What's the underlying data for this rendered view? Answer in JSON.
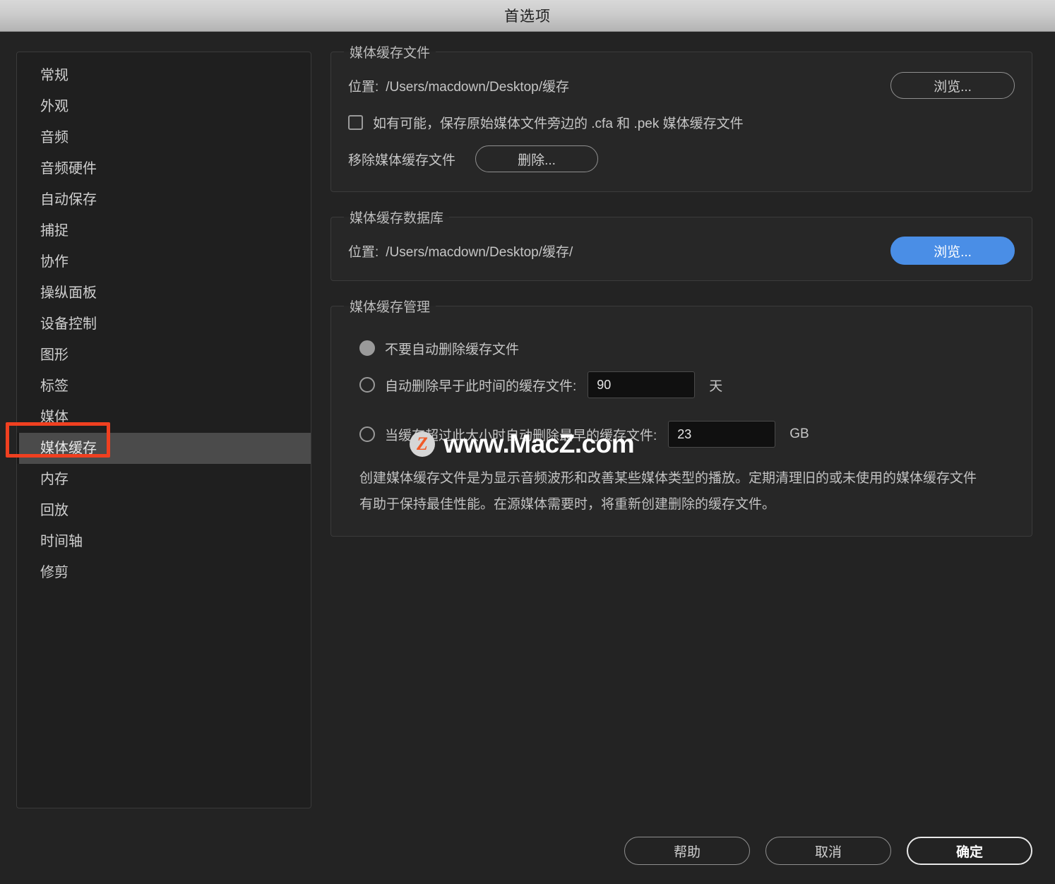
{
  "window": {
    "title": "首选项"
  },
  "sidebar": {
    "items": [
      {
        "label": "常规",
        "selected": false
      },
      {
        "label": "外观",
        "selected": false
      },
      {
        "label": "音频",
        "selected": false
      },
      {
        "label": "音频硬件",
        "selected": false
      },
      {
        "label": "自动保存",
        "selected": false
      },
      {
        "label": "捕捉",
        "selected": false
      },
      {
        "label": "协作",
        "selected": false
      },
      {
        "label": "操纵面板",
        "selected": false
      },
      {
        "label": "设备控制",
        "selected": false
      },
      {
        "label": "图形",
        "selected": false
      },
      {
        "label": "标签",
        "selected": false
      },
      {
        "label": "媒体",
        "selected": false
      },
      {
        "label": "媒体缓存",
        "selected": true
      },
      {
        "label": "内存",
        "selected": false
      },
      {
        "label": "回放",
        "selected": false
      },
      {
        "label": "时间轴",
        "selected": false
      },
      {
        "label": "修剪",
        "selected": false
      }
    ]
  },
  "media_cache_files": {
    "legend": "媒体缓存文件",
    "location_label": "位置:",
    "location_value": "/Users/macdown/Desktop/缓存",
    "browse_button": "浏览...",
    "checkbox_label": "如有可能，保存原始媒体文件旁边的 .cfa 和 .pek 媒体缓存文件",
    "checkbox_checked": false,
    "remove_label": "移除媒体缓存文件",
    "delete_button": "删除..."
  },
  "media_cache_database": {
    "legend": "媒体缓存数据库",
    "location_label": "位置:",
    "location_value": "/Users/macdown/Desktop/缓存/",
    "browse_button": "浏览...",
    "browse_button_color": "#4a8ee6"
  },
  "media_cache_management": {
    "legend": "媒体缓存管理",
    "option_never": "不要自动删除缓存文件",
    "option_older_than": "自动删除早于此时间的缓存文件:",
    "days_value": "90",
    "days_unit": "天",
    "option_exceeds_size": "当缓存超过此大小时自动删除最早的缓存文件:",
    "size_value": "23",
    "size_unit": "GB",
    "selected_option": "option_never",
    "description": "创建媒体缓存文件是为显示音频波形和改善某些媒体类型的播放。定期清理旧的或未使用的媒体缓存文件有助于保持最佳性能。在源媒体需要时，将重新创建删除的缓存文件。"
  },
  "footer": {
    "help_button": "帮助",
    "cancel_button": "取消",
    "ok_button": "确定"
  },
  "watermark": {
    "logo_letter": "Z",
    "text": "www.MacZ.com"
  },
  "annotation": {
    "highlight_color": "#f04020",
    "target": "媒体缓存"
  }
}
